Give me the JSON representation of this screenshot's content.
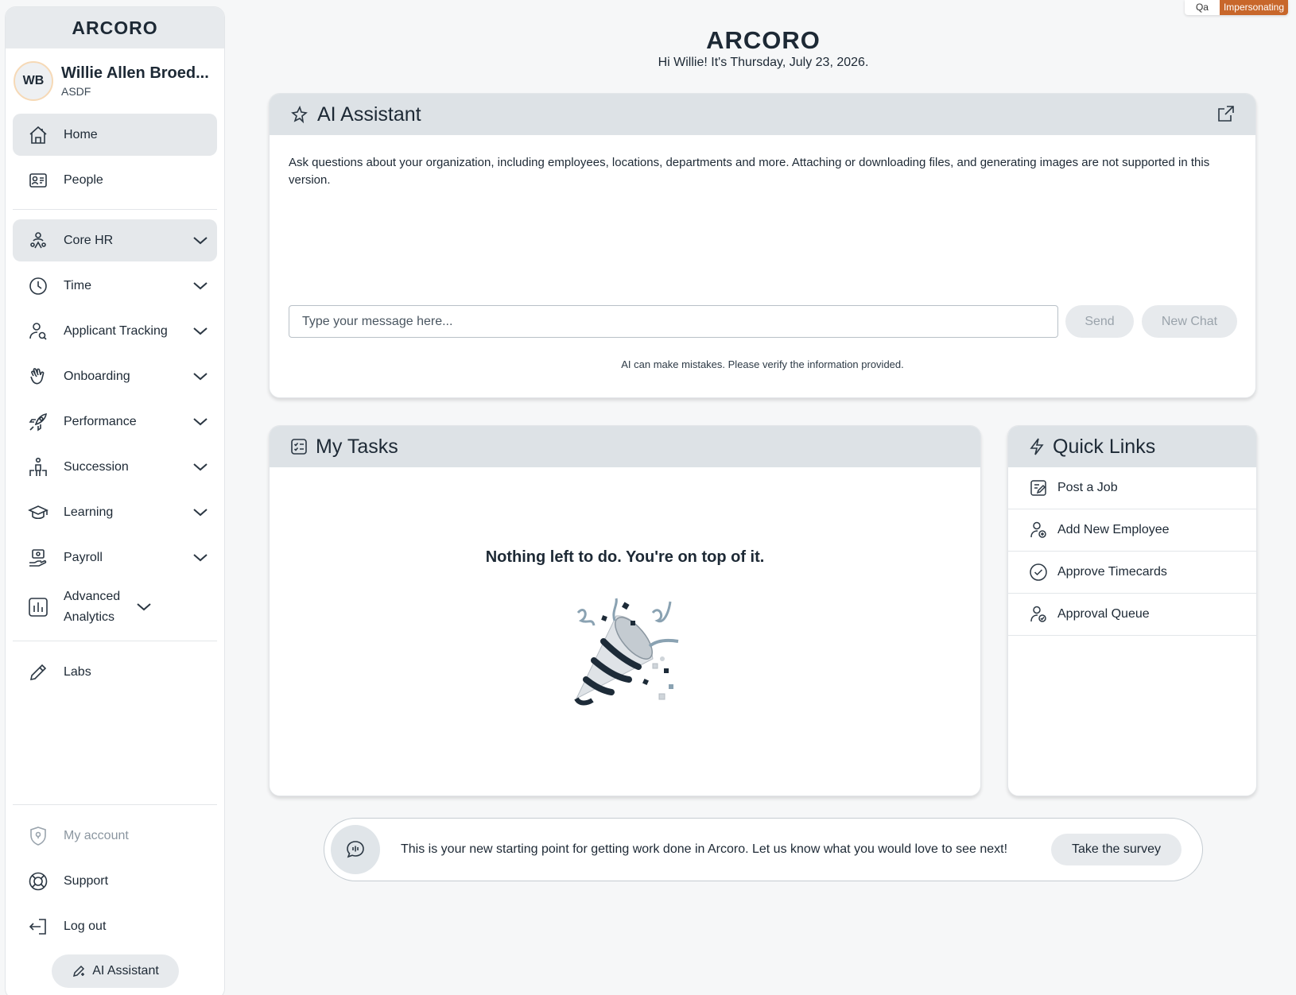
{
  "brand": {
    "logo_text": "ARCORO"
  },
  "impersonation": {
    "user": "Qa",
    "tag": "Impersonating"
  },
  "user": {
    "initials": "WB",
    "name": "Willie Allen Broed...",
    "org": "ASDF"
  },
  "sidebar": {
    "primary": [
      {
        "label": "Home",
        "icon": "home-icon",
        "active": true
      },
      {
        "label": "People",
        "icon": "id-card-icon"
      }
    ],
    "modules": [
      {
        "label": "Core HR",
        "icon": "people-hub-icon",
        "active": true
      },
      {
        "label": "Time",
        "icon": "clock-icon"
      },
      {
        "label": "Applicant Tracking",
        "icon": "person-search-icon"
      },
      {
        "label": "Onboarding",
        "icon": "wave-hand-icon"
      },
      {
        "label": "Performance",
        "icon": "rocket-icon"
      },
      {
        "label": "Succession",
        "icon": "succession-icon"
      },
      {
        "label": "Learning",
        "icon": "graduation-cap-icon"
      },
      {
        "label": "Payroll",
        "icon": "payroll-icon"
      },
      {
        "label": "Advanced Analytics",
        "icon": "bar-chart-icon"
      }
    ],
    "labs": {
      "label": "Labs",
      "icon": "pencil-icon"
    },
    "footer": [
      {
        "label": "My account",
        "icon": "shield-icon",
        "muted": true
      },
      {
        "label": "Support",
        "icon": "lifebuoy-icon"
      },
      {
        "label": "Log out",
        "icon": "logout-icon"
      }
    ],
    "ai_button": "AI Assistant"
  },
  "header": {
    "greeting": "Hi Willie! It's Thursday, July 23, 2026."
  },
  "ai_assistant": {
    "title": "AI Assistant",
    "description": "Ask questions about your organization, including employees, locations, departments and more. Attaching or downloading files, and generating images are not supported in this version.",
    "input_placeholder": "Type your message here...",
    "send_label": "Send",
    "new_chat_label": "New Chat",
    "disclaimer": "AI can make mistakes. Please verify the information provided."
  },
  "tasks": {
    "title": "My Tasks",
    "empty_message": "Nothing left to do. You're on top of it."
  },
  "quick_links": {
    "title": "Quick Links",
    "items": [
      {
        "label": "Post a Job",
        "icon": "edit-doc-icon"
      },
      {
        "label": "Add New Employee",
        "icon": "person-add-icon"
      },
      {
        "label": "Approve Timecards",
        "icon": "check-circle-icon"
      },
      {
        "label": "Approval Queue",
        "icon": "person-check-icon"
      }
    ]
  },
  "survey": {
    "text": "This is your new starting point for getting work done in Arcoro. Let us know what you would love to see next!",
    "button": "Take the survey"
  },
  "colors": {
    "accent_orange": "#c8672b",
    "panel_header": "#dde2e6",
    "active_nav": "#e5e8eb"
  }
}
